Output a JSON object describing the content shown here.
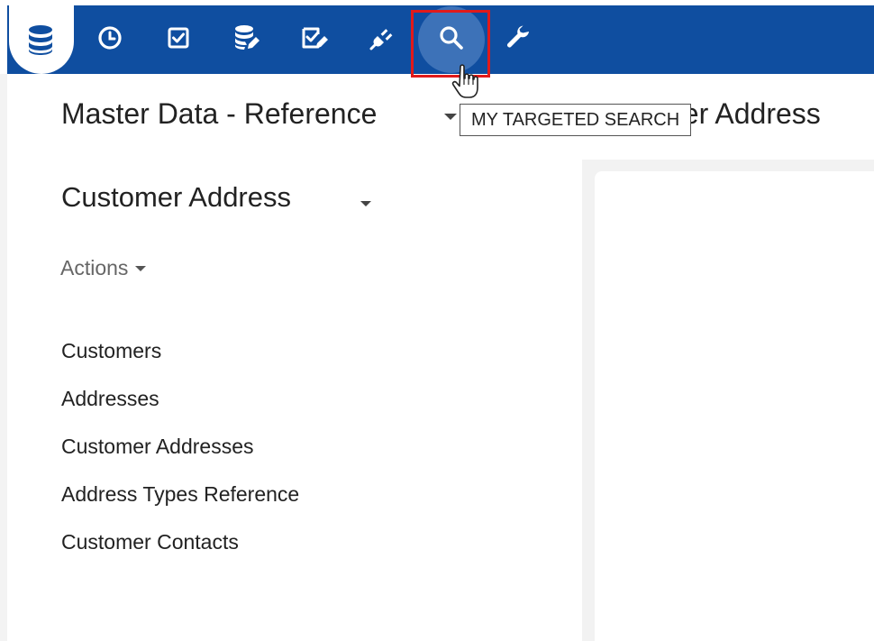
{
  "toolbar": {
    "tools": [
      {
        "icon": "database-icon"
      },
      {
        "icon": "clock-icon"
      },
      {
        "icon": "checkbox-icon"
      },
      {
        "icon": "database-edit-icon"
      },
      {
        "icon": "checklist-edit-icon"
      },
      {
        "icon": "plug-icon"
      },
      {
        "icon": "search-icon",
        "active": true
      },
      {
        "icon": "wrench-icon"
      }
    ],
    "tooltip": "MY TARGETED SEARCH",
    "colors": {
      "bar": "#0f4ea0",
      "active": "#3d72b8",
      "highlight": "#e11a1a"
    }
  },
  "header": {
    "title_left": "Master Data - Reference",
    "title_right": "ner Address"
  },
  "sidebar": {
    "section_title": "Customer Address",
    "actions_label": "Actions",
    "items": [
      {
        "label": "Customers"
      },
      {
        "label": "Addresses"
      },
      {
        "label": "Customer Addresses"
      },
      {
        "label": "Address Types Reference"
      },
      {
        "label": "Customer Contacts"
      }
    ]
  }
}
